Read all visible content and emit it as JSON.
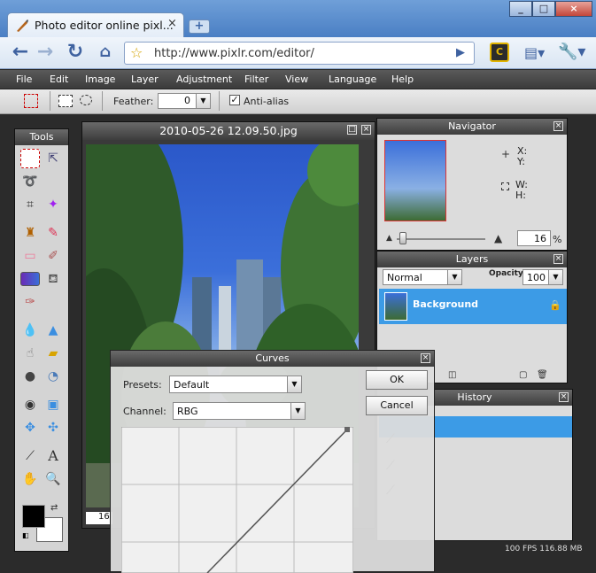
{
  "browser": {
    "tab_title": "Photo editor online pixl...",
    "tab_close": "×",
    "new_tab": "+",
    "url": "http://www.pixlr.com/editor/",
    "window_buttons": [
      "_",
      "□",
      "×"
    ]
  },
  "menu": [
    "File",
    "Edit",
    "Image",
    "Layer",
    "Adjustment",
    "Filter",
    "View",
    "Language",
    "Help"
  ],
  "options_bar": {
    "feather_label": "Feather:",
    "feather_value": "0",
    "antialias_label": "Anti-alias",
    "antialias_checked": true
  },
  "tools_panel": {
    "title": "Tools"
  },
  "document": {
    "title": "2010-05-26 12.09.50.jpg",
    "zoom_snippet": "16"
  },
  "navigator": {
    "title": "Navigator",
    "x_label": "X:",
    "y_label": "Y:",
    "w_label": "W:",
    "h_label": "H:",
    "zoom_value": "16",
    "zoom_unit": "%"
  },
  "layers": {
    "title": "Layers",
    "blend_mode": "Normal",
    "opacity_label": "Opacity:",
    "opacity_value": "100",
    "items": [
      {
        "name": "Background",
        "locked": true
      }
    ]
  },
  "history": {
    "title": "History"
  },
  "curves": {
    "title": "Curves",
    "presets_label": "Presets:",
    "presets_value": "Default",
    "channel_label": "Channel:",
    "channel_value": "RBG",
    "ok_label": "OK",
    "cancel_label": "Cancel"
  },
  "status": {
    "text": "100 FPS 116.88 MB"
  },
  "colors": {
    "accent_blue": "#3c9be6",
    "panel_bg": "#dcdcdc",
    "dark_bg": "#2b2b2b"
  }
}
